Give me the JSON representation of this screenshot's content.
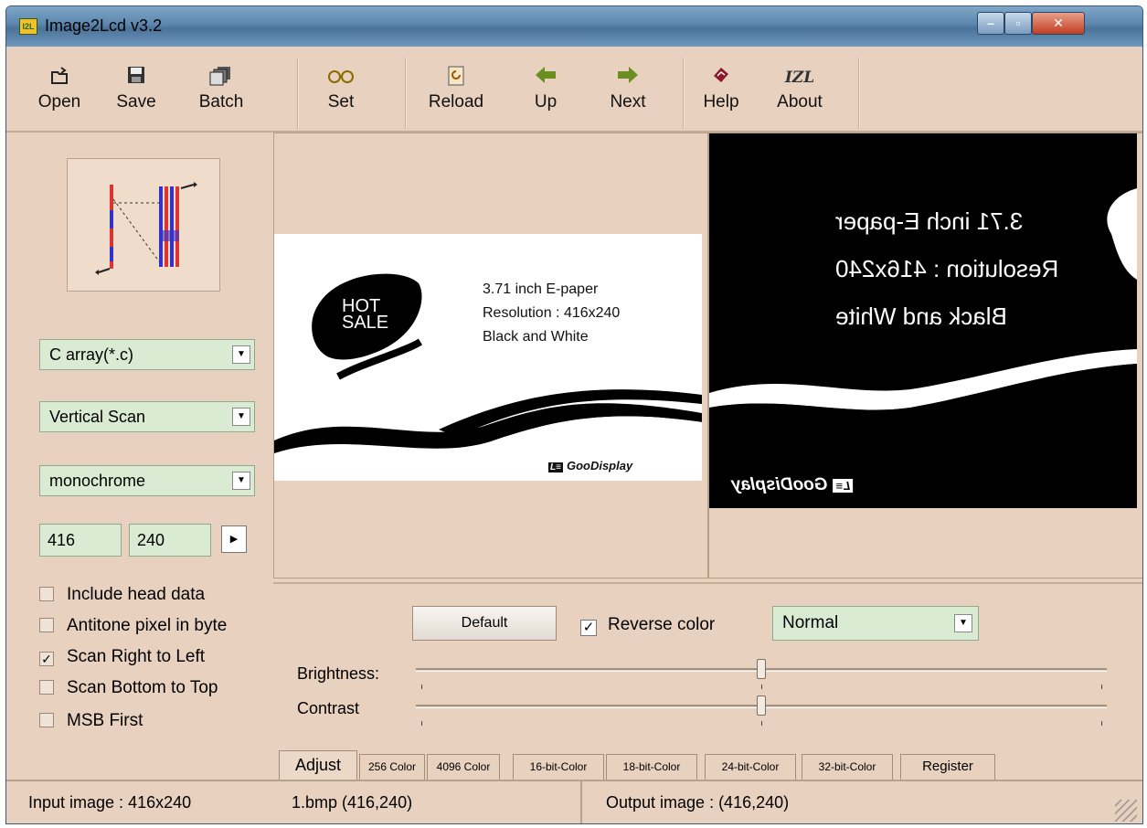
{
  "window": {
    "title": "Image2Lcd v3.2",
    "icon_text": "I2L"
  },
  "toolbar": {
    "buttons": [
      {
        "id": "open",
        "label": "Open",
        "icon": "open-folder-icon"
      },
      {
        "id": "save",
        "label": "Save",
        "icon": "floppy-icon"
      },
      {
        "id": "batch",
        "label": "Batch",
        "icon": "batch-icon"
      },
      {
        "id": "set",
        "label": "Set",
        "icon": "glasses-icon"
      },
      {
        "id": "reload",
        "label": "Reload",
        "icon": "reload-icon"
      },
      {
        "id": "up",
        "label": "Up",
        "icon": "arrow-left-icon"
      },
      {
        "id": "next",
        "label": "Next",
        "icon": "arrow-right-icon"
      },
      {
        "id": "help",
        "label": "Help",
        "icon": "help-book-icon"
      },
      {
        "id": "about",
        "label": "About",
        "icon": "izl-icon",
        "icon_text": "IZL"
      }
    ]
  },
  "left": {
    "output_format": "C array(*.c)",
    "scan_mode": "Vertical Scan",
    "color_depth": "monochrome",
    "width": "416",
    "height": "240",
    "options": [
      {
        "label": "Include head data",
        "checked": false
      },
      {
        "label": "Antitone pixel in byte",
        "checked": false
      },
      {
        "label": "Scan Right to Left",
        "checked": true
      },
      {
        "label": "Scan Bottom to Top",
        "checked": false
      },
      {
        "label": "MSB First",
        "checked": false
      }
    ]
  },
  "image": {
    "hot": "HOT",
    "sale": "SALE",
    "line1": "3.71 inch E-paper",
    "line2": "Resolution : 416x240",
    "line3": "Black and White",
    "brand": "GooDisplay",
    "brand_logo": "L≡"
  },
  "adjust": {
    "default_label": "Default",
    "reverse_label": "Reverse color",
    "reverse_checked": true,
    "mode": "Normal",
    "brightness_label": "Brightness:",
    "contrast_label": "Contrast",
    "brightness_level": 0.5,
    "contrast_level": 0.5,
    "tabs": [
      "Adjust",
      "256 Color",
      "4096 Color",
      "16-bit-Color",
      "18-bit-Color",
      "24-bit-Color",
      "32-bit-Color",
      "Register"
    ]
  },
  "status": {
    "input": "Input image : 416x240",
    "file": "1.bmp (416,240)",
    "output": "Output image : (416,240)"
  }
}
